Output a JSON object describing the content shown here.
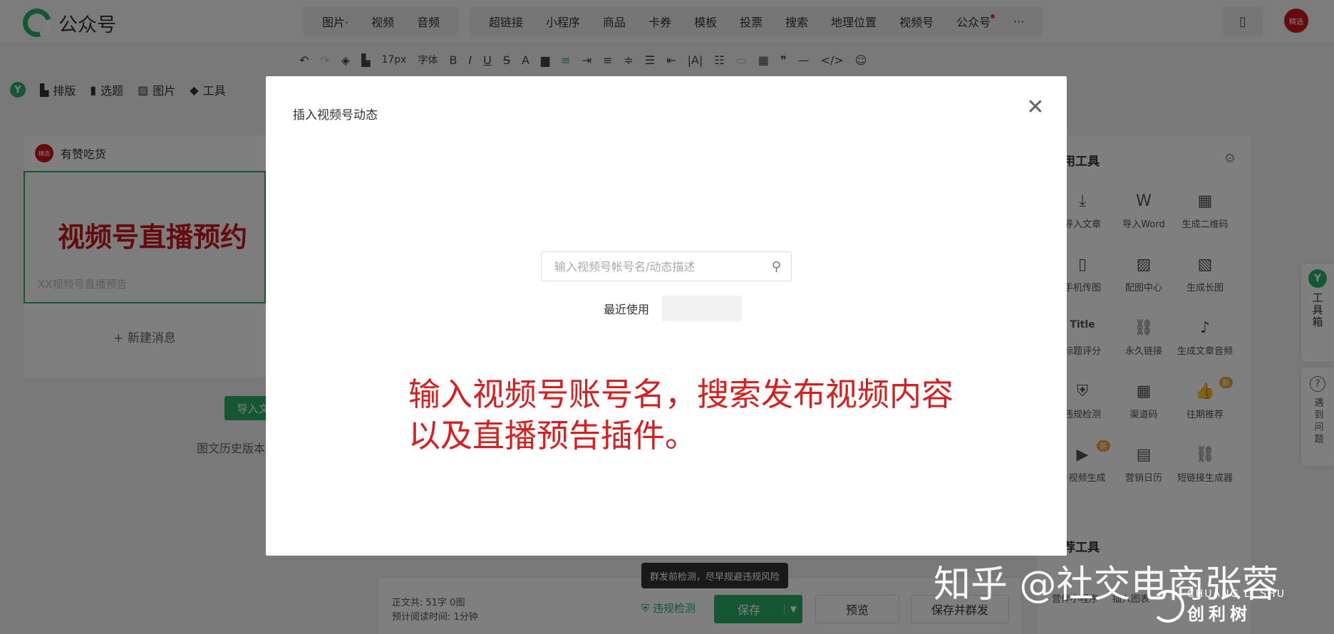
{
  "app": {
    "logo_text": "公众号"
  },
  "insert_menu": {
    "group1": [
      "图片·",
      "视频",
      "音频"
    ],
    "group2": [
      "超链接",
      "小程序",
      "商品",
      "卡券",
      "模板",
      "投票",
      "搜索",
      "地理位置",
      "视频号",
      "公众号",
      "···"
    ]
  },
  "toolbar": {
    "font_size": "17px",
    "font_family": "字体",
    "items": [
      "B",
      "I",
      "U",
      "S",
      "A"
    ]
  },
  "quickbar": {
    "items": [
      "排版",
      "选题",
      "图片",
      "工具"
    ]
  },
  "avatar_label": "精选",
  "left_panel": {
    "account_name": "有赞吃货",
    "card_title": "视频号直播预约",
    "card_subtitle": "XX视频号直播预告",
    "new_message": "+ 新建消息",
    "import_btn": "导入文",
    "history": "图文历史版本"
  },
  "right_panel": {
    "title": "用工具",
    "tools": [
      {
        "icon": "⤓",
        "label": "导入文章"
      },
      {
        "icon": "W",
        "label": "导入Word"
      },
      {
        "icon": "▦",
        "label": "生成二维码"
      },
      {
        "icon": "▯",
        "label": "手机传图"
      },
      {
        "icon": "▨",
        "label": "配图中心"
      },
      {
        "icon": "▧",
        "label": "生成长图"
      },
      {
        "icon": "Title",
        "label": "标题评分"
      },
      {
        "icon": "⛓",
        "label": "永久链接"
      },
      {
        "icon": "♪",
        "label": "生成文章音频"
      },
      {
        "icon": "⛨",
        "label": "违规检测"
      },
      {
        "icon": "▦",
        "label": "渠道码"
      },
      {
        "icon": "👍",
        "label": "往期推荐",
        "badge": "新"
      },
      {
        "icon": "▶",
        "label": "号视频生成",
        "badge": "新"
      },
      {
        "icon": "▤",
        "label": "营销日历"
      },
      {
        "icon": "⛓",
        "label": "短链接生成器"
      }
    ],
    "title2": "荐工具",
    "bottom_tools": [
      "营伴小程序",
      "插入图表"
    ]
  },
  "side_float": {
    "logo": "Y",
    "toolbox": "工具箱",
    "help": "遇到问题"
  },
  "bottom_bar": {
    "stats_line1": "正文共:  51字 0图",
    "stats_line2": "预计阅读时间:   1分钟",
    "check": "违规检测",
    "save": "保存",
    "preview": "预览",
    "save_send": "保存并群发",
    "tooltip": "群发前检测，尽早规避违规风险"
  },
  "dialog": {
    "title": "插入视频号动态",
    "search_placeholder": "输入视频号帐号名/动态描述",
    "recent_label": "最近使用",
    "annotation_line1": "输入视频号账号名，搜索发布视频内容",
    "annotation_line2": "以及直播预告插件。"
  },
  "watermark": {
    "text": "知乎 @社交电商张蓉",
    "brand_en": "CHUANG LI SHU",
    "brand_cn": "创利树"
  }
}
